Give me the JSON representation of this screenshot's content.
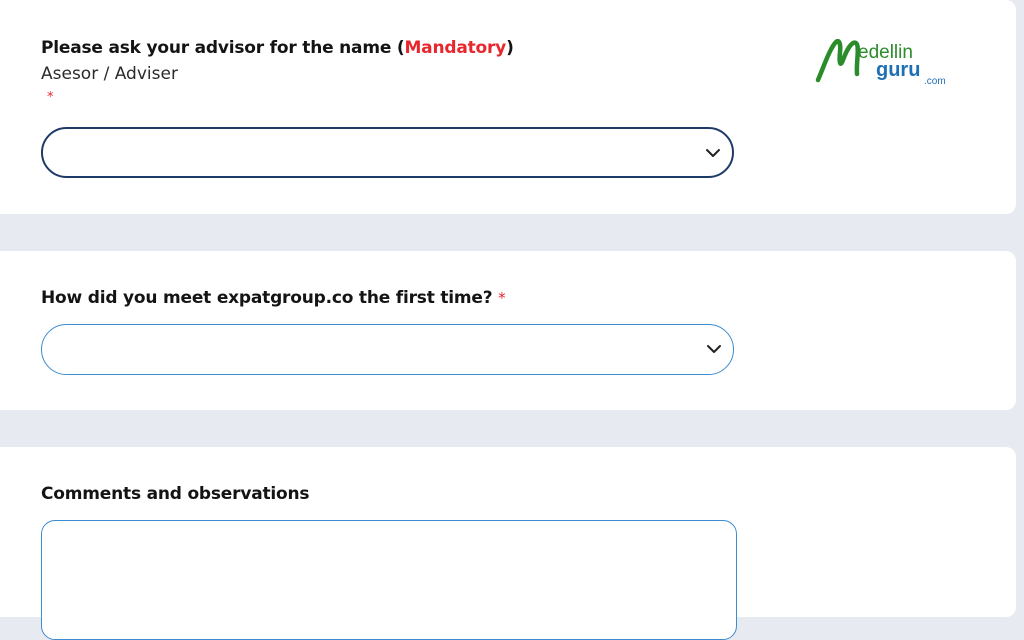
{
  "logo": {
    "text_main": "edellin",
    "text_guru": "guru",
    "text_com": ".com",
    "brand_green": "#2a8c2a",
    "brand_blue": "#1f6fb5"
  },
  "questions": [
    {
      "title_prefix": "Please ask your advisor for the name (",
      "title_mandatory": "Mandatory",
      "title_suffix": ")",
      "subtitle": "Asesor / Adviser",
      "required_mark": "*",
      "control": "select",
      "value": ""
    },
    {
      "title": "How did you meet expatgroup.co the first time?",
      "required_mark": "*",
      "control": "select",
      "value": ""
    },
    {
      "title": "Comments and observations",
      "control": "textarea",
      "value": ""
    }
  ],
  "colors": {
    "required": "#e8262d",
    "input_border": "#3d8ccf",
    "focused_border": "#1e3a66",
    "page_bg": "#e8eaf1"
  }
}
